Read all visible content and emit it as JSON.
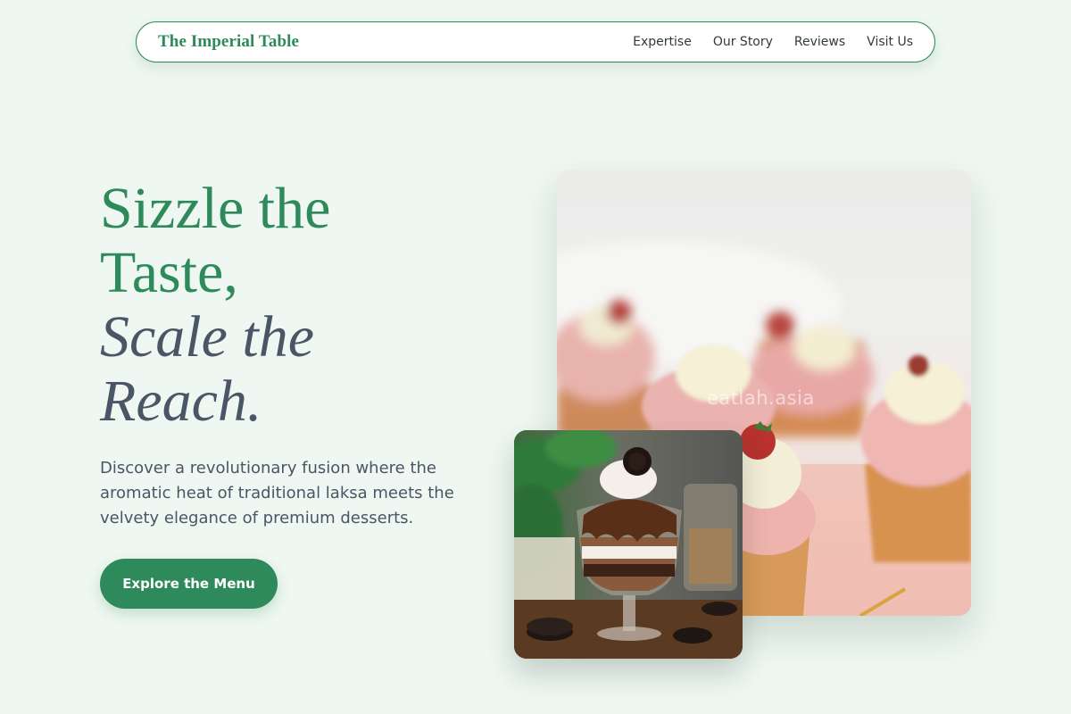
{
  "nav": {
    "brand": "The Imperial Table",
    "links": [
      {
        "label": "Expertise"
      },
      {
        "label": "Our Story"
      },
      {
        "label": "Reviews"
      },
      {
        "label": "Visit Us"
      }
    ]
  },
  "hero": {
    "title_line1": "Sizzle the",
    "title_line2": "Taste,",
    "title_line3": "Scale the",
    "title_line4": "Reach.",
    "description": "Discover a revolutionary fusion where the aromatic heat of traditional laksa meets the velvety elegance of premium desserts.",
    "cta_label": "Explore the Menu"
  },
  "images": {
    "main_watermark": "eatlah.asia"
  },
  "colors": {
    "accent": "#2e8a5a",
    "text_slate": "#4a5565",
    "background": "#eef7f1"
  }
}
